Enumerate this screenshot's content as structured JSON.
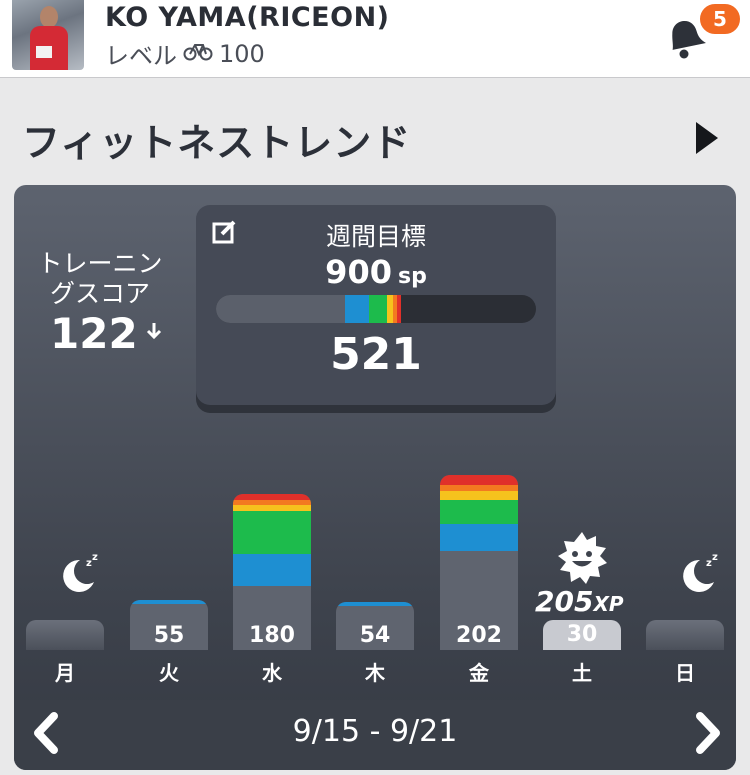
{
  "header": {
    "username": "KO YAMA(RICEON)",
    "level_label": "レベル",
    "level_value": "100",
    "bike_icon": "bike-icon",
    "notifications": "5"
  },
  "section": {
    "title": "フィットネストレンド"
  },
  "score": {
    "label_line1": "トレーニン",
    "label_line2": "グスコア",
    "value": "122",
    "trend": "down"
  },
  "goal": {
    "label": "週間目標",
    "target": "900",
    "unit": "sp",
    "current": "521",
    "progress_fraction": 0.579
  },
  "days": [
    {
      "label": "月",
      "type": "rest"
    },
    {
      "label": "火",
      "type": "bar",
      "value": "55"
    },
    {
      "label": "水",
      "type": "bar",
      "value": "180"
    },
    {
      "label": "木",
      "type": "bar",
      "value": "54"
    },
    {
      "label": "金",
      "type": "bar",
      "value": "202"
    },
    {
      "label": "土",
      "type": "xp",
      "value": "30",
      "xp": "205",
      "xp_unit": "XP"
    },
    {
      "label": "日",
      "type": "rest"
    }
  ],
  "week": {
    "range": "9/15 - 9/21"
  },
  "colors": {
    "accent": "#f26a22",
    "zone_blue": "#1e8fd2",
    "zone_green": "#1dbb4c",
    "zone_yellow": "#f6c21d",
    "zone_orange": "#f37a20",
    "zone_red": "#e0302a",
    "base_gray": "#5f646f"
  }
}
